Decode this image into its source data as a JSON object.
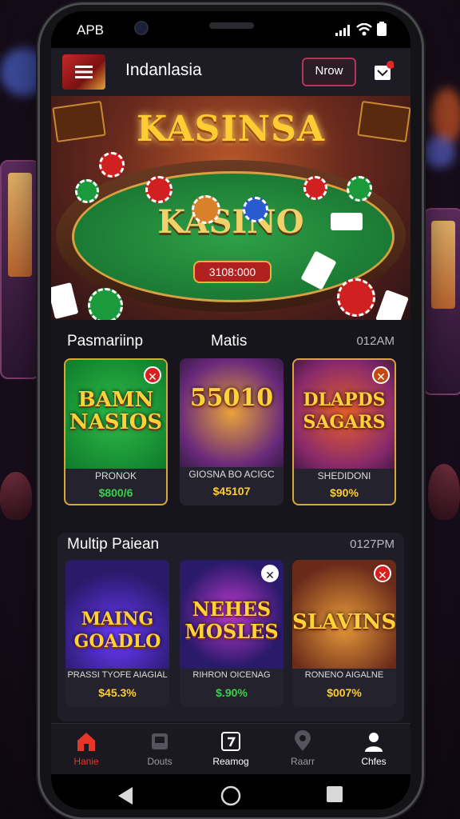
{
  "status": {
    "time": "APB"
  },
  "appbar": {
    "title": "Indanlasia",
    "action_label": "Nrow"
  },
  "banner": {
    "title": "KASINSA",
    "table_label": "KASINO",
    "jackpot": "3108:000"
  },
  "section1": {
    "left_label": "Pasmariinp",
    "middle_label": "Matis",
    "right_label": "012AM",
    "games": [
      {
        "art_title": "BAMN NASIOS",
        "name": "PRONOK",
        "value": "$800/6",
        "value_color": "#3ad04a"
      },
      {
        "art_title": "55010",
        "name": "GIOSNA BO ACIGC",
        "value": "$45107",
        "value_color": "#ffcc33"
      },
      {
        "art_title": "DLAPDS SAGARS",
        "name": "SHEDIDONI",
        "value": "$90%",
        "value_color": "#ffcc33"
      }
    ]
  },
  "section2": {
    "left_label": "Multip Paiean",
    "right_label": "0127PM",
    "games": [
      {
        "art_title": "MAING GOADLO",
        "name": "PRASSI TYOFE AIAGIAL",
        "value": "$45.3%",
        "value_color": "#ffcc33"
      },
      {
        "art_title": "NEHES MOSLES",
        "name": "RIHRON OICENAG",
        "value": "$.90%",
        "value_color": "#3ad04a"
      },
      {
        "art_title": "SLAVINS",
        "name": "RONENO AIGALNE",
        "value": "$007%",
        "value_color": "#ffcc33"
      }
    ]
  },
  "tabs": [
    {
      "label": "Hanie",
      "icon": "home-icon",
      "active": true
    },
    {
      "label": "Douts",
      "icon": "slot-icon"
    },
    {
      "label": "Reamog",
      "icon": "cards-icon"
    },
    {
      "label": "Raarr",
      "icon": "pin-icon"
    },
    {
      "label": "Chfes",
      "icon": "user-icon"
    }
  ],
  "colors": {
    "accent": "#d9a53a",
    "active_tab": "#e8352a",
    "panel": "#24232d"
  }
}
